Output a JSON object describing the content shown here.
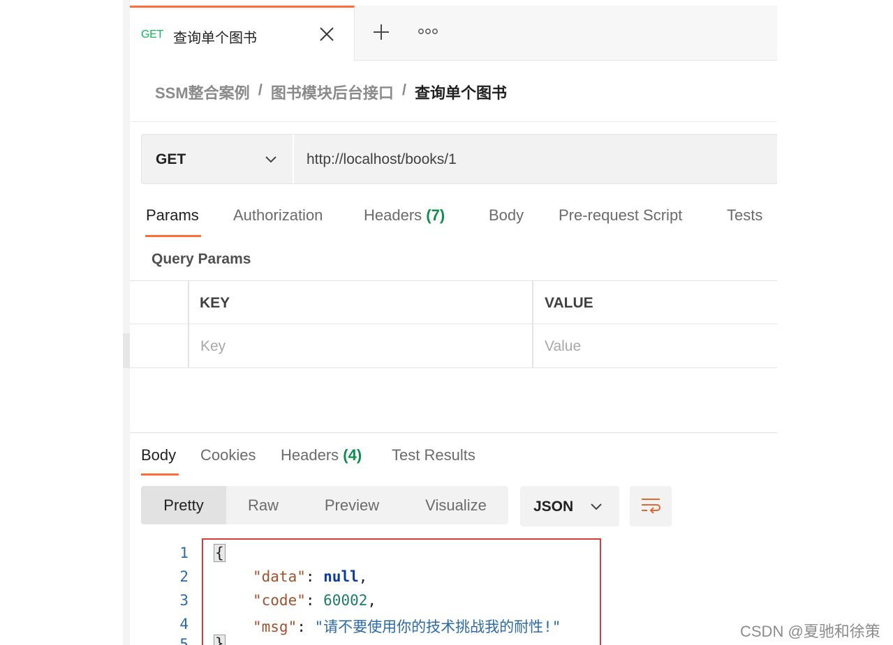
{
  "tab": {
    "method": "GET",
    "title": "查询单个图书",
    "accent": "#ff6c37"
  },
  "breadcrumb": {
    "items": [
      "SSM整合案例",
      "图书模块后台接口"
    ],
    "separator": "/",
    "current": "查询单个图书"
  },
  "request": {
    "method": "GET",
    "url": "http://localhost/books/1"
  },
  "request_tabs": [
    {
      "label": "Params"
    },
    {
      "label": "Authorization"
    },
    {
      "label": "Headers",
      "count": "(7)"
    },
    {
      "label": "Body"
    },
    {
      "label": "Pre-request Script"
    },
    {
      "label": "Tests"
    }
  ],
  "query_params": {
    "title": "Query Params",
    "columns": [
      "KEY",
      "VALUE"
    ],
    "placeholders": [
      "Key",
      "Value"
    ]
  },
  "response_tabs": [
    {
      "label": "Body"
    },
    {
      "label": "Cookies"
    },
    {
      "label": "Headers",
      "count": "(4)"
    },
    {
      "label": "Test Results"
    }
  ],
  "view_modes": [
    "Pretty",
    "Raw",
    "Preview",
    "Visualize"
  ],
  "format": "JSON",
  "code": {
    "line_numbers": [
      "1",
      "2",
      "3",
      "4",
      "5"
    ],
    "open_brace": "{",
    "close_brace": "}",
    "data_key": "\"data\"",
    "data_value": "null",
    "code_key": "\"code\"",
    "code_value": "60002",
    "msg_key": "\"msg\"",
    "msg_value": "\"请不要使用你的技术挑战我的耐性!\"",
    "colon": ": ",
    "comma": ","
  },
  "watermark": "CSDN @夏驰和徐策",
  "icons": {
    "close": "close-icon",
    "new_tab": "plus-icon",
    "more": "more-icon",
    "chevron": "chevron-down-icon",
    "wrap": "wrap-lines-icon"
  }
}
